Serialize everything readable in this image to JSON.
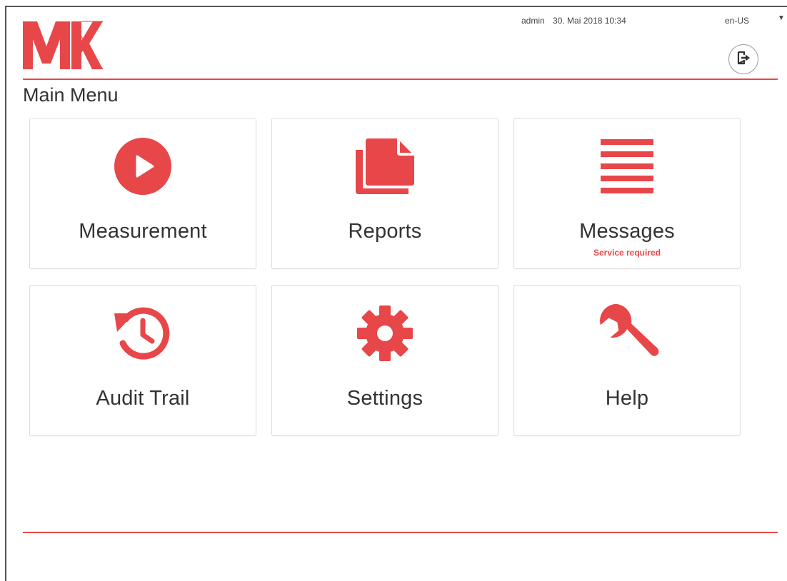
{
  "brand": {
    "logo_text": "MK",
    "accent_color": "#e8474a"
  },
  "header": {
    "user": "admin",
    "datetime": "30. Mai 2018 10:34",
    "language": "en-US",
    "logout_icon": "logout-icon"
  },
  "page": {
    "title": "Main Menu"
  },
  "tiles": [
    {
      "label": "Measurement",
      "icon": "play-icon"
    },
    {
      "label": "Reports",
      "icon": "documents-icon"
    },
    {
      "label": "Messages",
      "icon": "list-icon",
      "status": "Service required"
    },
    {
      "label": "Audit Trail",
      "icon": "history-icon"
    },
    {
      "label": "Settings",
      "icon": "gear-icon"
    },
    {
      "label": "Help",
      "icon": "wrench-icon"
    }
  ]
}
